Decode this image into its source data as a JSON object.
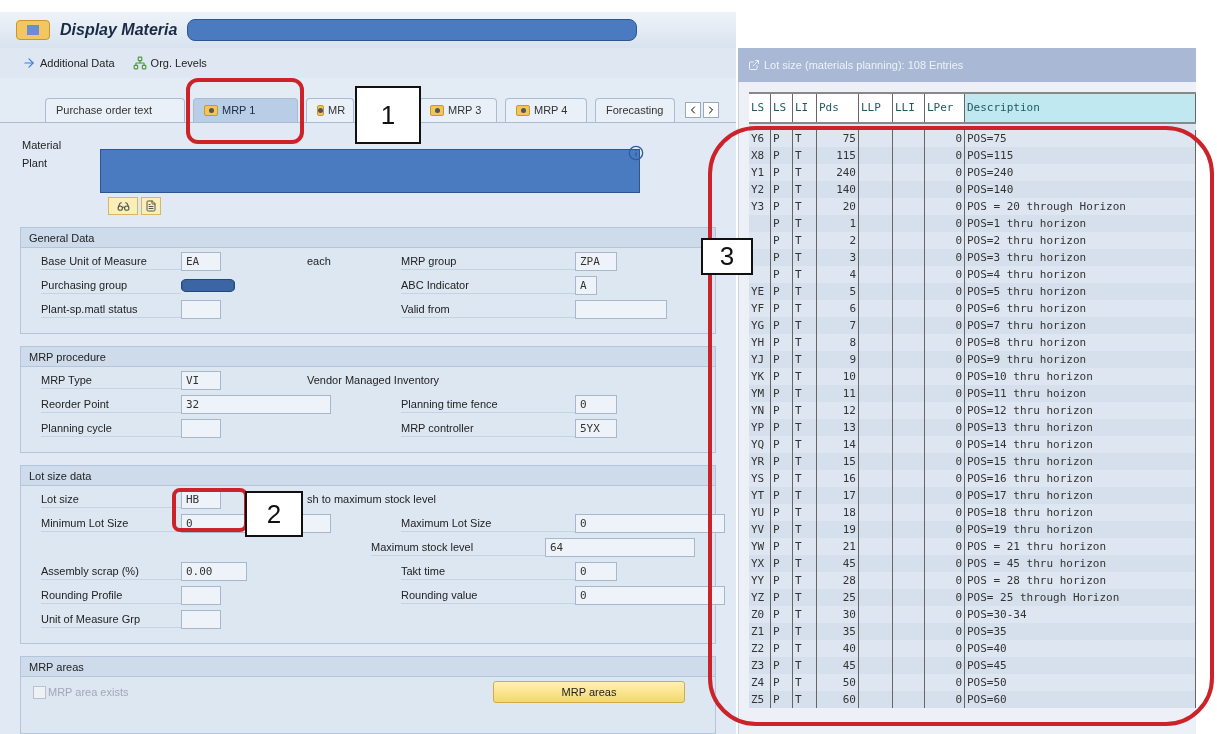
{
  "window": {
    "title": "Display Materia",
    "title_redacted": true
  },
  "toolbar": [
    "Additional Data",
    "Org. Levels"
  ],
  "tabs": [
    {
      "label": "Purchase order text",
      "selected": false,
      "has_icon": false
    },
    {
      "label": "MRP 1",
      "selected": true,
      "has_icon": true
    },
    {
      "label": "MR",
      "selected": false,
      "has_icon": true
    },
    {
      "label": "MRP 3",
      "selected": false,
      "has_icon": true
    },
    {
      "label": "MRP 4",
      "selected": false,
      "has_icon": true
    },
    {
      "label": "Forecasting",
      "selected": false,
      "has_icon": false
    }
  ],
  "header": {
    "labels": [
      "Material",
      "Plant"
    ],
    "redacted": true
  },
  "sections": [
    {
      "title": "General Data",
      "rows": [
        {
          "left": {
            "label": "Base Unit of Measure",
            "value": "EA",
            "kind": "short",
            "text": "each"
          },
          "right": {
            "label": "MRP group",
            "value": "ZPA",
            "kind": "short"
          }
        },
        {
          "left": {
            "label": "Purchasing group",
            "kind": "short",
            "redacted": true
          },
          "right": {
            "label": "ABC Indicator",
            "value": "A",
            "kind": "tiny"
          }
        },
        {
          "left": {
            "label": "Plant-sp.matl status",
            "kind": "short"
          },
          "right": {
            "label": "Valid from",
            "kind": "medium"
          }
        }
      ]
    },
    {
      "title": "MRP procedure",
      "rows": [
        {
          "left": {
            "label": "MRP Type",
            "value": "VI",
            "kind": "short",
            "text": "Vendor Managed Inventory"
          }
        },
        {
          "left": {
            "label": "Reorder Point",
            "value": "32",
            "kind": "long"
          },
          "right": {
            "label": "Planning time fence",
            "value": "0",
            "kind": "short"
          }
        },
        {
          "left": {
            "label": "Planning cycle",
            "kind": "short"
          },
          "right": {
            "label": "MRP controller",
            "value": "5YX",
            "kind": "short"
          }
        }
      ]
    },
    {
      "title": "Lot size data",
      "rows": [
        {
          "left": {
            "label": "Lot size",
            "value": "HB",
            "kind": "short",
            "text": "sh to maximum stock level"
          }
        },
        {
          "left": {
            "label": "Minimum Lot Size",
            "value": "0",
            "kind": "long"
          },
          "right": {
            "label": "Maximum Lot Size",
            "value": "0",
            "kind": "long"
          }
        },
        {
          "right": {
            "label": "Maximum stock level",
            "value": "64",
            "kind": "long"
          }
        },
        {
          "left": {
            "label": "Assembly scrap (%)",
            "value": "0.00",
            "kind": "medium"
          },
          "right": {
            "label": "Takt time",
            "value": "0",
            "kind": "short"
          }
        },
        {
          "left": {
            "label": "Rounding Profile",
            "kind": "short"
          },
          "right": {
            "label": "Rounding value",
            "value": "0",
            "kind": "long"
          }
        },
        {
          "left": {
            "label": "Unit of Measure Grp",
            "kind": "short"
          }
        }
      ]
    }
  ],
  "mrp_areas": {
    "title": "MRP areas",
    "checkbox": {
      "label": "MRP area exists",
      "checked": false,
      "disabled": true
    },
    "button": "MRP areas"
  },
  "popup": {
    "title": "Lot size (materials planning): 108 Entries",
    "columns": [
      "LS",
      "LS",
      "LI",
      "Pds",
      "LLP",
      "LLI",
      "LPer",
      "Description"
    ],
    "rows": [
      {
        "ls": "Y6",
        "ls2": "P",
        "li": "T",
        "pds": "75",
        "lper": "0",
        "description": "POS=75"
      },
      {
        "ls": "X8",
        "ls2": "P",
        "li": "T",
        "pds": "115",
        "lper": "0",
        "description": "POS=115"
      },
      {
        "ls": "Y1",
        "ls2": "P",
        "li": "T",
        "pds": "240",
        "lper": "0",
        "description": "POS=240"
      },
      {
        "ls": "Y2",
        "ls2": "P",
        "li": "T",
        "pds": "140",
        "lper": "0",
        "description": "POS=140"
      },
      {
        "ls": "Y3",
        "ls2": "P",
        "li": "T",
        "pds": "20",
        "lper": "0",
        "description": "POS = 20 through Horizon"
      },
      {
        "ls2": "P",
        "li": "T",
        "pds": "1",
        "lper": "0",
        "description": "POS=1 thru horizon"
      },
      {
        "ls2": "P",
        "li": "T",
        "pds": "2",
        "lper": "0",
        "description": "POS=2 thru horizon"
      },
      {
        "ls2": "P",
        "li": "T",
        "pds": "3",
        "lper": "0",
        "description": "POS=3 thru horizon"
      },
      {
        "ls2": "P",
        "li": "T",
        "pds": "4",
        "lper": "0",
        "description": "POS=4 thru horizon"
      },
      {
        "ls": "YE",
        "ls2": "P",
        "li": "T",
        "pds": "5",
        "lper": "0",
        "description": "POS=5 thru horizon"
      },
      {
        "ls": "YF",
        "ls2": "P",
        "li": "T",
        "pds": "6",
        "lper": "0",
        "description": "POS=6 thru horizon"
      },
      {
        "ls": "YG",
        "ls2": "P",
        "li": "T",
        "pds": "7",
        "lper": "0",
        "description": "POS=7 thru horizon"
      },
      {
        "ls": "YH",
        "ls2": "P",
        "li": "T",
        "pds": "8",
        "lper": "0",
        "description": "POS=8 thru horizon"
      },
      {
        "ls": "YJ",
        "ls2": "P",
        "li": "T",
        "pds": "9",
        "lper": "0",
        "description": "POS=9 thru horizon"
      },
      {
        "ls": "YK",
        "ls2": "P",
        "li": "T",
        "pds": "10",
        "lper": "0",
        "description": "POS=10 thru horizon"
      },
      {
        "ls": "YM",
        "ls2": "P",
        "li": "T",
        "pds": "11",
        "lper": "0",
        "description": "POS=11 thru hoizon"
      },
      {
        "ls": "YN",
        "ls2": "P",
        "li": "T",
        "pds": "12",
        "lper": "0",
        "description": "POS=12 thru horizon"
      },
      {
        "ls": "YP",
        "ls2": "P",
        "li": "T",
        "pds": "13",
        "lper": "0",
        "description": "POS=13 thru horizon"
      },
      {
        "ls": "YQ",
        "ls2": "P",
        "li": "T",
        "pds": "14",
        "lper": "0",
        "description": "POS=14 thru horizon"
      },
      {
        "ls": "YR",
        "ls2": "P",
        "li": "T",
        "pds": "15",
        "lper": "0",
        "description": "POS=15 thru horizon"
      },
      {
        "ls": "YS",
        "ls2": "P",
        "li": "T",
        "pds": "16",
        "lper": "0",
        "description": "POS=16 thru horizon"
      },
      {
        "ls": "YT",
        "ls2": "P",
        "li": "T",
        "pds": "17",
        "lper": "0",
        "description": "POS=17 thru horizon"
      },
      {
        "ls": "YU",
        "ls2": "P",
        "li": "T",
        "pds": "18",
        "lper": "0",
        "description": "POS=18 thru horizon"
      },
      {
        "ls": "YV",
        "ls2": "P",
        "li": "T",
        "pds": "19",
        "lper": "0",
        "description": "POS=19 thru horizon"
      },
      {
        "ls": "YW",
        "ls2": "P",
        "li": "T",
        "pds": "21",
        "lper": "0",
        "description": "POS = 21 thru horizon"
      },
      {
        "ls": "YX",
        "ls2": "P",
        "li": "T",
        "pds": "45",
        "lper": "0",
        "description": "POS = 45 thru horizon"
      },
      {
        "ls": "YY",
        "ls2": "P",
        "li": "T",
        "pds": "28",
        "lper": "0",
        "description": "POS = 28 thru horizon"
      },
      {
        "ls": "YZ",
        "ls2": "P",
        "li": "T",
        "pds": "25",
        "lper": "0",
        "description": "POS= 25 through Horizon"
      },
      {
        "ls": "Z0",
        "ls2": "P",
        "li": "T",
        "pds": "30",
        "lper": "0",
        "description": "POS=30-34"
      },
      {
        "ls": "Z1",
        "ls2": "P",
        "li": "T",
        "pds": "35",
        "lper": "0",
        "description": "POS=35"
      },
      {
        "ls": "Z2",
        "ls2": "P",
        "li": "T",
        "pds": "40",
        "lper": "0",
        "description": "POS=40"
      },
      {
        "ls": "Z3",
        "ls2": "P",
        "li": "T",
        "pds": "45",
        "lper": "0",
        "description": "POS=45"
      },
      {
        "ls": "Z4",
        "ls2": "P",
        "li": "T",
        "pds": "50",
        "lper": "0",
        "description": "POS=50"
      },
      {
        "ls": "Z5",
        "ls2": "P",
        "li": "T",
        "pds": "60",
        "lper": "0",
        "description": "POS=60"
      }
    ]
  },
  "callouts": [
    "1",
    "2",
    "3"
  ]
}
